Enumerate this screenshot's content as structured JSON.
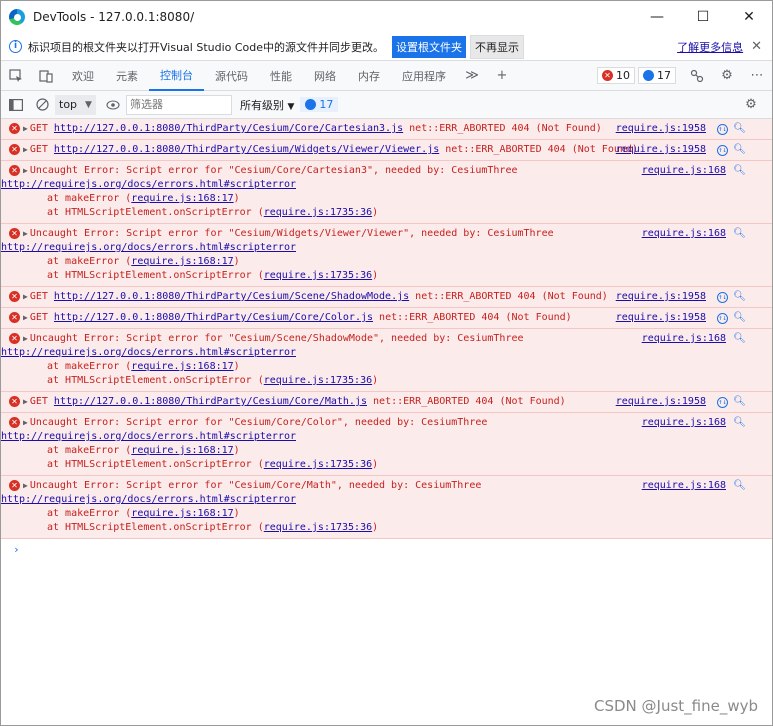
{
  "window": {
    "title": "DevTools - 127.0.0.1:8080/",
    "controls": {
      "minimize": "—",
      "maximize": "☐",
      "close": "✕"
    }
  },
  "infobar": {
    "icon": "i",
    "text": "标识项目的根文件夹以打开Visual Studio Code中的源文件并同步更改。",
    "set_root_label": "设置根文件夹",
    "dismiss_label": "不再显示",
    "learn_more_label": "了解更多信息",
    "close_label": "✕"
  },
  "tabs": [
    {
      "label": "欢迎"
    },
    {
      "label": "元素"
    },
    {
      "label": "控制台",
      "active": true
    },
    {
      "label": "源代码"
    },
    {
      "label": "性能"
    },
    {
      "label": "网络"
    },
    {
      "label": "内存"
    },
    {
      "label": "应用程序"
    }
  ],
  "tabbar": {
    "more": "≫",
    "add": "+",
    "error_count": "10",
    "message_count": "17",
    "settings": "⚙"
  },
  "console_toolbar": {
    "context": "top",
    "filter_placeholder": "筛选器",
    "levels_label": "所有级别",
    "message_count": "17"
  },
  "entries": [
    {
      "kind": "get",
      "method": "GET",
      "url": "http://127.0.0.1:8080/ThirdParty/Cesium/Core/Cartesian3.js",
      "msg": "net::ERR_ABORTED 404 (Not Found)",
      "src": "require.js:1958"
    },
    {
      "kind": "get",
      "method": "GET",
      "url": "http://127.0.0.1:8080/ThirdParty/Cesium/Widgets/Viewer/Viewer.js",
      "msg": "net::ERR_ABORTED 404 (Not Found)",
      "src": "require.js:1958"
    },
    {
      "kind": "error",
      "msg": "Uncaught Error: Script error for \"Cesium/Core/Cartesian3\", needed by: CesiumThree",
      "url": "http://requirejs.org/docs/errors.html#scripterror",
      "stack1_prefix": "at makeError (",
      "stack1_link": "require.js:168:17",
      "stack1_suffix": ")",
      "stack2_prefix": "at HTMLScriptElement.onScriptError (",
      "stack2_link": "require.js:1735:36",
      "stack2_suffix": ")",
      "src": "require.js:168"
    },
    {
      "kind": "error",
      "msg": "Uncaught Error: Script error for \"Cesium/Widgets/Viewer/Viewer\", needed by: CesiumThree",
      "url": "http://requirejs.org/docs/errors.html#scripterror",
      "stack1_prefix": "at makeError (",
      "stack1_link": "require.js:168:17",
      "stack1_suffix": ")",
      "stack2_prefix": "at HTMLScriptElement.onScriptError (",
      "stack2_link": "require.js:1735:36",
      "stack2_suffix": ")",
      "src": "require.js:168"
    },
    {
      "kind": "get",
      "method": "GET",
      "url": "http://127.0.0.1:8080/ThirdParty/Cesium/Scene/ShadowMode.js",
      "msg": "net::ERR_ABORTED 404 (Not Found)",
      "src": "require.js:1958"
    },
    {
      "kind": "get",
      "method": "GET",
      "url": "http://127.0.0.1:8080/ThirdParty/Cesium/Core/Color.js",
      "msg": "net::ERR_ABORTED 404 (Not Found)",
      "src": "require.js:1958"
    },
    {
      "kind": "error",
      "msg": "Uncaught Error: Script error for \"Cesium/Scene/ShadowMode\", needed by: CesiumThree",
      "url": "http://requirejs.org/docs/errors.html#scripterror",
      "stack1_prefix": "at makeError (",
      "stack1_link": "require.js:168:17",
      "stack1_suffix": ")",
      "stack2_prefix": "at HTMLScriptElement.onScriptError (",
      "stack2_link": "require.js:1735:36",
      "stack2_suffix": ")",
      "src": "require.js:168"
    },
    {
      "kind": "get",
      "method": "GET",
      "url": "http://127.0.0.1:8080/ThirdParty/Cesium/Core/Math.js",
      "msg": "net::ERR_ABORTED 404 (Not Found)",
      "src": "require.js:1958"
    },
    {
      "kind": "error",
      "msg": "Uncaught Error: Script error for \"Cesium/Core/Color\", needed by: CesiumThree",
      "url": "http://requirejs.org/docs/errors.html#scripterror",
      "stack1_prefix": "at makeError (",
      "stack1_link": "require.js:168:17",
      "stack1_suffix": ")",
      "stack2_prefix": "at HTMLScriptElement.onScriptError (",
      "stack2_link": "require.js:1735:36",
      "stack2_suffix": ")",
      "src": "require.js:168"
    },
    {
      "kind": "error",
      "msg": "Uncaught Error: Script error for \"Cesium/Core/Math\", needed by: CesiumThree",
      "url": "http://requirejs.org/docs/errors.html#scripterror",
      "stack1_prefix": "at makeError (",
      "stack1_link": "require.js:168:17",
      "stack1_suffix": ")",
      "stack2_prefix": "at HTMLScriptElement.onScriptError (",
      "stack2_link": "require.js:1735:36",
      "stack2_suffix": ")",
      "src": "require.js:168"
    }
  ],
  "prompt": "›",
  "watermark": "CSDN @Just_fine_wyb",
  "colors": {
    "accent": "#1a73e8",
    "error": "#d93025",
    "error_bg": "#fcebeb"
  }
}
